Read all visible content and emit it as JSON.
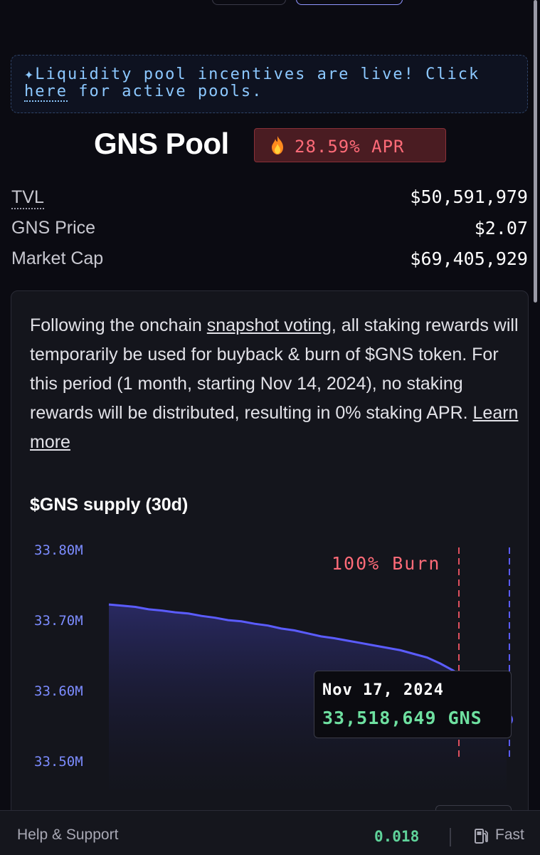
{
  "banner": {
    "line1": "✦Liquidity pool incentives are live! Click",
    "line2_link": "here",
    "line2_rest": " for active pools."
  },
  "pool": {
    "title": "GNS Pool",
    "apr_icon": "fire-icon",
    "apr": "28.59% APR"
  },
  "stats": [
    {
      "label": "TVL",
      "value": "$50,591,979"
    },
    {
      "label": "GNS Price",
      "value": "$2.07"
    },
    {
      "label": "Market Cap",
      "value": "$69,405,929"
    }
  ],
  "notice": {
    "pre": "Following the onchain ",
    "link": "snapshot voting",
    "mid": ", all staking rewards will temporarily be used for buyback & burn of $GNS token. For this period (1 month, starting Nov 14, 2024), no staking rewards will be distributed, resulting in 0% staking APR. ",
    "learn_more": "Learn more"
  },
  "chart_data": {
    "type": "area",
    "title": "$GNS supply (30d)",
    "y_ticks": [
      "33.80M",
      "33.70M",
      "33.60M",
      "33.50M"
    ],
    "ylim": [
      33450000,
      33800000
    ],
    "values": [
      33710000,
      33708000,
      33706000,
      33702000,
      33700000,
      33697000,
      33695000,
      33691000,
      33688000,
      33684000,
      33682000,
      33678000,
      33675000,
      33670000,
      33667000,
      33662000,
      33657000,
      33654000,
      33650000,
      33646000,
      33642000,
      33638000,
      33634000,
      33628000,
      33622000,
      33612000,
      33600000,
      33585000,
      33565000,
      33540000,
      33518649
    ],
    "annotation": "100% Burn",
    "line_color": "#5b5cff",
    "burn_color": "#e0505e",
    "tooltip": {
      "date": "Nov 17, 2024",
      "value": "33,518,649 GNS"
    }
  },
  "footer": {
    "help": "Help & Support",
    "gas": "0.018",
    "speed_icon": "gas-pump-icon",
    "speed": "Fast"
  }
}
